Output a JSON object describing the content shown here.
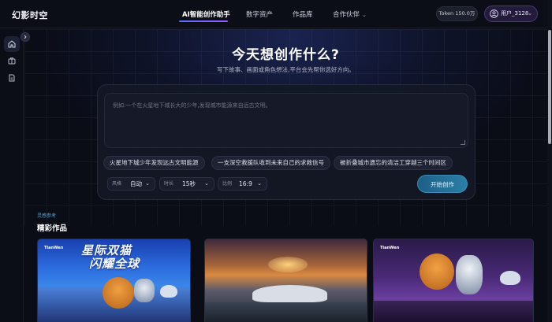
{
  "app": {
    "brand": "幻影时空"
  },
  "nav": {
    "links": [
      {
        "label": "AI智能创作助手",
        "active": true
      },
      {
        "label": "数字资产",
        "active": false
      },
      {
        "label": "作品库",
        "active": false
      },
      {
        "label": "合作伙伴",
        "active": false,
        "has_dropdown": true
      }
    ]
  },
  "header": {
    "token": "Token 150.0万",
    "user": "用户_3128"
  },
  "sidebar": {
    "items": [
      {
        "icon": "home-icon",
        "active": true
      },
      {
        "icon": "briefcase-icon",
        "active": false
      },
      {
        "icon": "document-icon",
        "active": false
      }
    ]
  },
  "hero": {
    "title": "今天想创作什么?",
    "subtitle": "写下故事、画面或角色想法,平台会先帮你选好方向。"
  },
  "composer": {
    "placeholder": "例如:一个在火星地下城长大的少年,发现城市能源来自远古文明。",
    "suggestions": [
      "火星地下城少年发现远古文明能源",
      "一支深空救援队收到未来自己的求救信号",
      "被折叠城市遗忘的清洁工穿越三个时间区"
    ],
    "style": {
      "label": "风格",
      "value": "自动"
    },
    "duration": {
      "label": "时长",
      "value": "15秒"
    },
    "ratio": {
      "label": "比例",
      "value": "16:9"
    },
    "start_label": "开始创作"
  },
  "gallery": {
    "kicker": "灵感参考",
    "title": "精彩作品",
    "cards": [
      {
        "logo": "TianWen",
        "title_line1": "星际双猫",
        "title_line2": "闪耀全球"
      },
      {
        "logo": ""
      },
      {
        "logo": "TianWen"
      }
    ]
  },
  "colors": {
    "accent": "#5b6cff",
    "start_button": "#2a7fa6",
    "background": "#0a0c16"
  }
}
